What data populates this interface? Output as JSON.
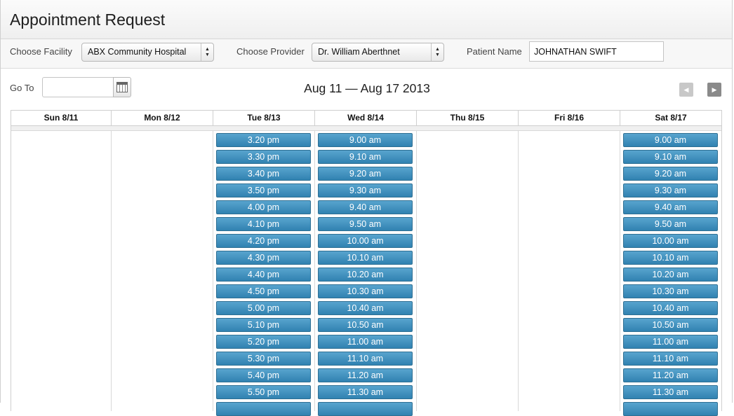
{
  "title": "Appointment Request",
  "filters": {
    "facility_label": "Choose Facility",
    "facility_value": "ABX Community Hospital",
    "provider_label": "Choose Provider",
    "provider_value": "Dr. William Aberthnet",
    "patient_label": "Patient Name",
    "patient_value": "JOHNATHAN SWIFT"
  },
  "toolbar": {
    "goto_label": "Go To",
    "goto_value": "",
    "date_range": "Aug 11 — Aug 17 2013",
    "prev_icon": "chevron-left-icon",
    "next_icon": "chevron-right-icon"
  },
  "days": [
    {
      "label": "Sun 8/11",
      "slots": []
    },
    {
      "label": "Mon 8/12",
      "slots": []
    },
    {
      "label": "Tue 8/13",
      "slots": [
        "3.20 pm",
        "3.30 pm",
        "3.40 pm",
        "3.50 pm",
        "4.00 pm",
        "4.10 pm",
        "4.20 pm",
        "4.30 pm",
        "4.40 pm",
        "4.50 pm",
        "5.00 pm",
        "5.10 pm",
        "5.20 pm",
        "5.30 pm",
        "5.40 pm",
        "5.50 pm",
        ""
      ]
    },
    {
      "label": "Wed 8/14",
      "slots": [
        "9.00 am",
        "9.10 am",
        "9.20 am",
        "9.30 am",
        "9.40 am",
        "9.50 am",
        "10.00 am",
        "10.10 am",
        "10.20 am",
        "10.30 am",
        "10.40 am",
        "10.50 am",
        "11.00 am",
        "11.10 am",
        "11.20 am",
        "11.30 am",
        ""
      ]
    },
    {
      "label": "Thu 8/15",
      "slots": []
    },
    {
      "label": "Fri 8/16",
      "slots": []
    },
    {
      "label": "Sat 8/17",
      "slots": [
        "9.00 am",
        "9.10 am",
        "9.20 am",
        "9.30 am",
        "9.40 am",
        "9.50 am",
        "10.00 am",
        "10.10 am",
        "10.20 am",
        "10.30 am",
        "10.40 am",
        "10.50 am",
        "11.00 am",
        "11.10 am",
        "11.20 am",
        "11.30 am",
        ""
      ]
    }
  ],
  "colors": {
    "slot_button": "#3d8fbe",
    "header_bg": "#f5f5f5"
  }
}
